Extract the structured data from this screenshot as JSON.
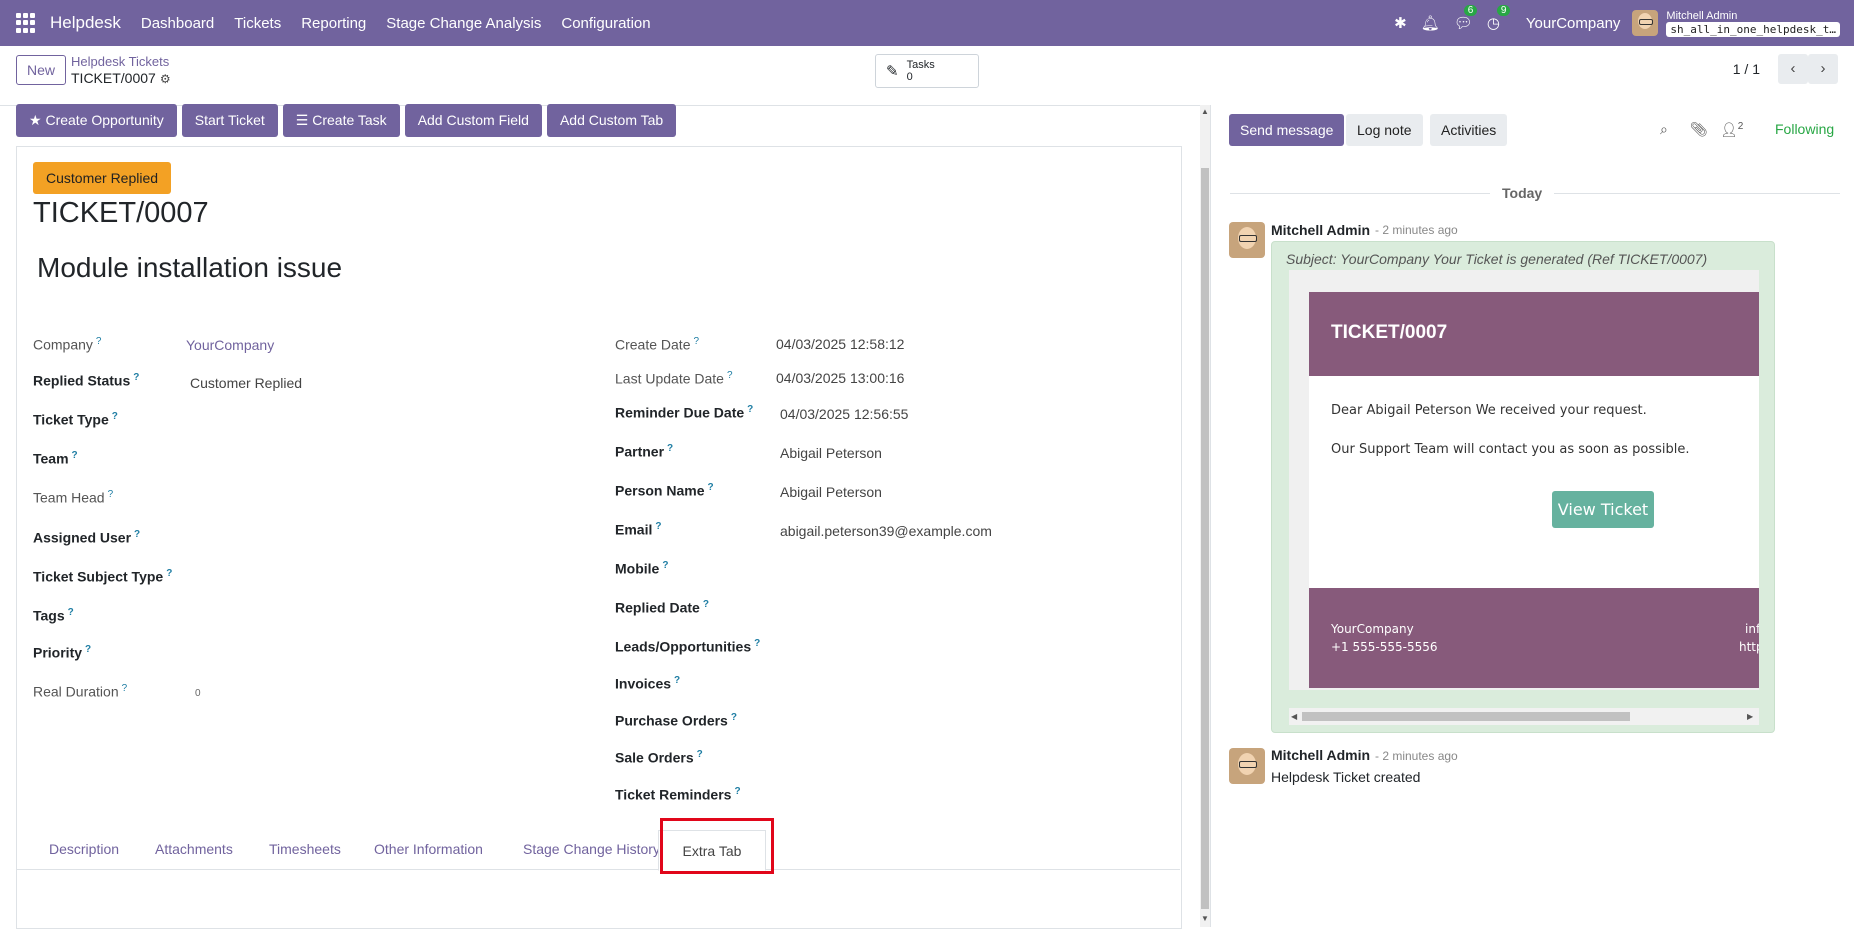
{
  "nav": {
    "brand": "Helpdesk",
    "menu": [
      "Dashboard",
      "Tickets",
      "Reporting",
      "Stage Change Analysis",
      "Configuration"
    ],
    "messages_count": "6",
    "activities_count": "9",
    "company": "YourCompany",
    "user": "Mitchell Admin",
    "database": "sh_all_in_one_helpdesk_t…"
  },
  "control": {
    "new_label": "New",
    "breadcrumb": "Helpdesk Tickets",
    "record": "TICKET/0007",
    "tasks_label": "Tasks",
    "tasks_count": "0",
    "pager": "1 / 1"
  },
  "actions": [
    "Create Opportunity",
    "Start Ticket",
    "Create Task",
    "Add Custom Field",
    "Add Custom Tab"
  ],
  "ticket": {
    "status": "Customer Replied",
    "number": "TICKET/0007",
    "subject": "Module installation issue"
  },
  "left_fields": [
    {
      "label": "Company",
      "value": "YourCompany"
    },
    {
      "label": "Replied Status",
      "value": "Customer Replied"
    },
    {
      "label": "Ticket Type",
      "value": ""
    },
    {
      "label": "Team",
      "value": ""
    },
    {
      "label": "Team Head",
      "value": ""
    },
    {
      "label": "Assigned User",
      "value": ""
    },
    {
      "label": "Ticket Subject Type",
      "value": ""
    },
    {
      "label": "Tags",
      "value": ""
    },
    {
      "label": "Priority",
      "value": ""
    },
    {
      "label": "Real Duration",
      "value": "0"
    }
  ],
  "right_fields": [
    {
      "label": "Create Date",
      "value": "04/03/2025 12:58:12"
    },
    {
      "label": "Last Update Date",
      "value": "04/03/2025 13:00:16"
    },
    {
      "label": "Reminder Due Date",
      "value": "04/03/2025 12:56:55"
    },
    {
      "label": "Partner",
      "value": "Abigail Peterson"
    },
    {
      "label": "Person Name",
      "value": "Abigail Peterson"
    },
    {
      "label": "Email",
      "value": "abigail.peterson39@example.com"
    },
    {
      "label": "Mobile",
      "value": ""
    },
    {
      "label": "Replied Date",
      "value": ""
    },
    {
      "label": "Leads/Opportunities",
      "value": ""
    },
    {
      "label": "Invoices",
      "value": ""
    },
    {
      "label": "Purchase Orders",
      "value": ""
    },
    {
      "label": "Sale Orders",
      "value": ""
    },
    {
      "label": "Ticket Reminders",
      "value": ""
    }
  ],
  "tabs": [
    "Description",
    "Attachments",
    "Timesheets",
    "Other Information",
    "Stage Change History",
    "Extra Tab"
  ],
  "chatter": {
    "send_message": "Send message",
    "log_note": "Log note",
    "activities": "Activities",
    "followers_count": "2",
    "following": "Following",
    "today": "Today",
    "msg1": {
      "author": "Mitchell Admin",
      "time": "- 2 minutes ago",
      "subject": "Subject: YourCompany Your Ticket is generated (Ref TICKET/0007)",
      "mail_title": "TICKET/0007",
      "line1": "Dear Abigail Peterson We received your request.",
      "line2": "Our Support Team will contact you as soon as possible.",
      "button": "View Ticket",
      "footer_company": "YourCompany",
      "footer_phone": "+1 555-555-5556",
      "footer_right1": "inf",
      "footer_right2": "http"
    },
    "msg2": {
      "author": "Mitchell Admin",
      "time": "- 2 minutes ago",
      "body": "Helpdesk Ticket created"
    }
  }
}
